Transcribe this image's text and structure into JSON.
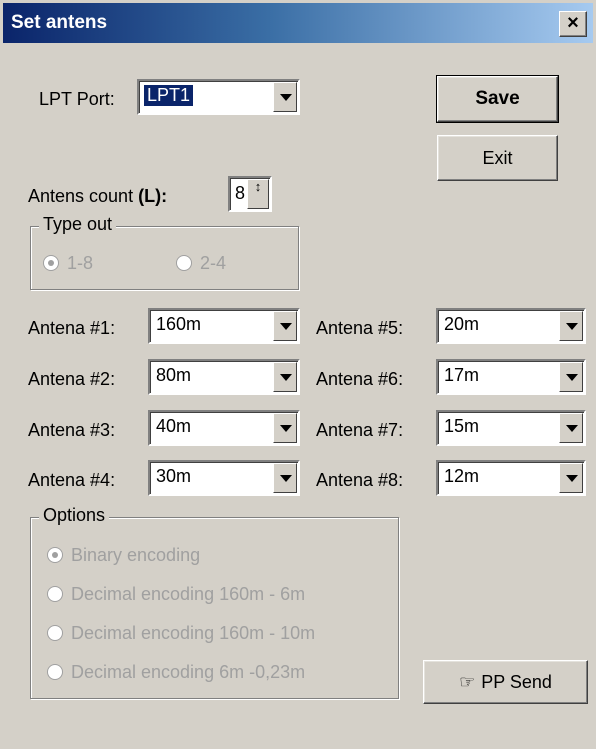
{
  "window": {
    "title": "Set antens",
    "close": "×"
  },
  "lpt": {
    "label": "LPT Port:",
    "value": "LPT1"
  },
  "buttons": {
    "save": "Save",
    "exit": "Exit",
    "pp_send": "PP Send"
  },
  "count": {
    "label": "Antens count",
    "label_bold": "(L):",
    "value": "8"
  },
  "type_out": {
    "legend": "Type out",
    "option1": "1-8",
    "option2": "2-4",
    "selected": "1-8"
  },
  "antennas": [
    {
      "label": "Antena #1:",
      "value": "160m"
    },
    {
      "label": "Antena #2:",
      "value": "80m"
    },
    {
      "label": "Antena #3:",
      "value": "40m"
    },
    {
      "label": "Antena #4:",
      "value": "30m"
    },
    {
      "label": "Antena #5:",
      "value": "20m"
    },
    {
      "label": "Antena #6:",
      "value": "17m"
    },
    {
      "label": "Antena #7:",
      "value": "15m"
    },
    {
      "label": "Antena #8:",
      "value": "12m"
    }
  ],
  "options": {
    "legend": "Options",
    "items": [
      "Binary encoding",
      "Decimal encoding 160m - 6m",
      "Decimal encoding 160m - 10m",
      "Decimal encoding 6m -0,23m"
    ],
    "selected": "Binary encoding"
  }
}
